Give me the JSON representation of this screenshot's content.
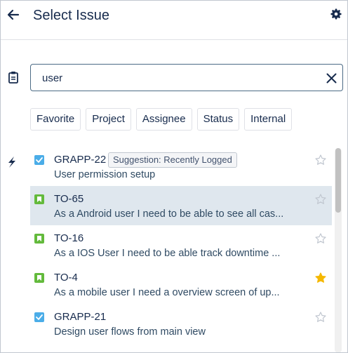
{
  "header": {
    "title": "Select Issue"
  },
  "search": {
    "value": "user"
  },
  "filters": [
    "Favorite",
    "Project",
    "Assignee",
    "Status",
    "Internal"
  ],
  "issues": [
    {
      "key": "GRAPP-22",
      "badge": "Suggestion: Recently Logged",
      "summary": "User permission setup",
      "type": "task",
      "starred": false
    },
    {
      "key": "TO-65",
      "summary": "As a Android user I need to be able to see all cas...",
      "type": "story",
      "starred": false
    },
    {
      "key": "TO-16",
      "summary": "As a IOS User I need to be able track downtime ...",
      "type": "story",
      "starred": false
    },
    {
      "key": "TO-4",
      "summary": "As a mobile user I need a overview screen of up...",
      "type": "story",
      "starred": true
    },
    {
      "key": "GRAPP-21",
      "summary": "Design user flows from main view",
      "type": "task",
      "starred": false
    }
  ],
  "colors": {
    "accent": "#4c6b85",
    "star": "#f5b800",
    "selected_row": "#dfe7ee",
    "task": "#4bade8",
    "story": "#63ba3c"
  },
  "icons": [
    "arrow-left-icon",
    "gear-icon",
    "clipboard-icon",
    "close-icon",
    "lightning-icon",
    "checkbox-icon",
    "bookmark-icon",
    "star-icon"
  ]
}
